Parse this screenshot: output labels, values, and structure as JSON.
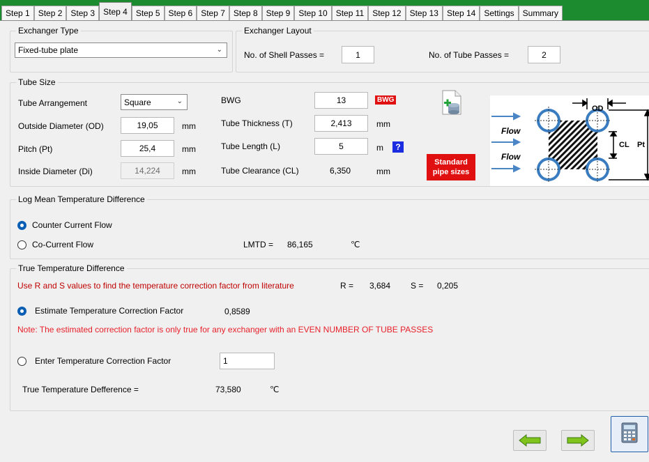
{
  "tabs": [
    "Step 1",
    "Step 2",
    "Step 3",
    "Step 4",
    "Step 5",
    "Step 6",
    "Step 7",
    "Step 8",
    "Step 9",
    "Step 10",
    "Step 11",
    "Step 12",
    "Step 13",
    "Step 14",
    "Settings",
    "Summary"
  ],
  "active_tab": "Step 4",
  "exchanger_type": {
    "title": "Exchanger Type",
    "value": "Fixed-tube plate"
  },
  "exchanger_layout": {
    "title": "Exchanger Layout",
    "shell_label": "No. of Shell Passes =",
    "shell_value": "1",
    "tube_label": "No. of Tube Passes =",
    "tube_value": "2"
  },
  "tube_size": {
    "title": "Tube Size",
    "arrangement_label": "Tube Arrangement",
    "arrangement_value": "Square",
    "od_label": "Outside Diameter (OD)",
    "od_value": "19,05",
    "od_unit": "mm",
    "pitch_label": "Pitch (Pt)",
    "pitch_value": "25,4",
    "pitch_unit": "mm",
    "id_label": "Inside Diameter (Di)",
    "id_value": "14,224",
    "id_unit": "mm",
    "bwg_label": "BWG",
    "bwg_value": "13",
    "bwg_badge": "BWG",
    "thickness_label": "Tube Thickness (T)",
    "thickness_value": "2,413",
    "thickness_unit": "mm",
    "length_label": "Tube Length (L)",
    "length_value": "5",
    "length_unit": "m",
    "help": "?",
    "clearance_label": "Tube Clearance (CL)",
    "clearance_value": "6,350",
    "clearance_unit": "mm",
    "std_pipe_line1": "Standard",
    "std_pipe_line2": "pipe sizes",
    "diagram": {
      "flow1": "Flow",
      "flow2": "Flow",
      "od": "OD",
      "cl": "CL",
      "pt": "Pt"
    }
  },
  "lmtd": {
    "title": "Log Mean Temperature Difference",
    "counter_label": "Counter Current Flow",
    "counter_selected": true,
    "co_label": "Co-Current Flow",
    "co_selected": false,
    "lmtd_label": "LMTD =",
    "lmtd_value": "86,165",
    "lmtd_unit": "℃"
  },
  "true_temp": {
    "title": "True Temperature Difference",
    "instruction": "Use R and S values to find the temperature correction factor from literature",
    "r_label": "R =",
    "r_value": "3,684",
    "s_label": "S =",
    "s_value": "0,205",
    "estimate_label": "Estimate Temperature Correction Factor",
    "estimate_value": "0,8589",
    "estimate_selected": true,
    "note": "Note: The estimated correction factor is only true for any exchanger with an EVEN NUMBER OF TUBE PASSES",
    "enter_label": "Enter Temperature Correction Factor",
    "enter_value": "1",
    "enter_selected": false,
    "result_label": "True Temperature Defference =",
    "result_value": "73,580",
    "result_unit": "℃"
  },
  "colors": {
    "tabbar": "#1c8a2e",
    "accent": "#0a5fb4",
    "warning": "#c00000",
    "badge": "#e01010"
  }
}
